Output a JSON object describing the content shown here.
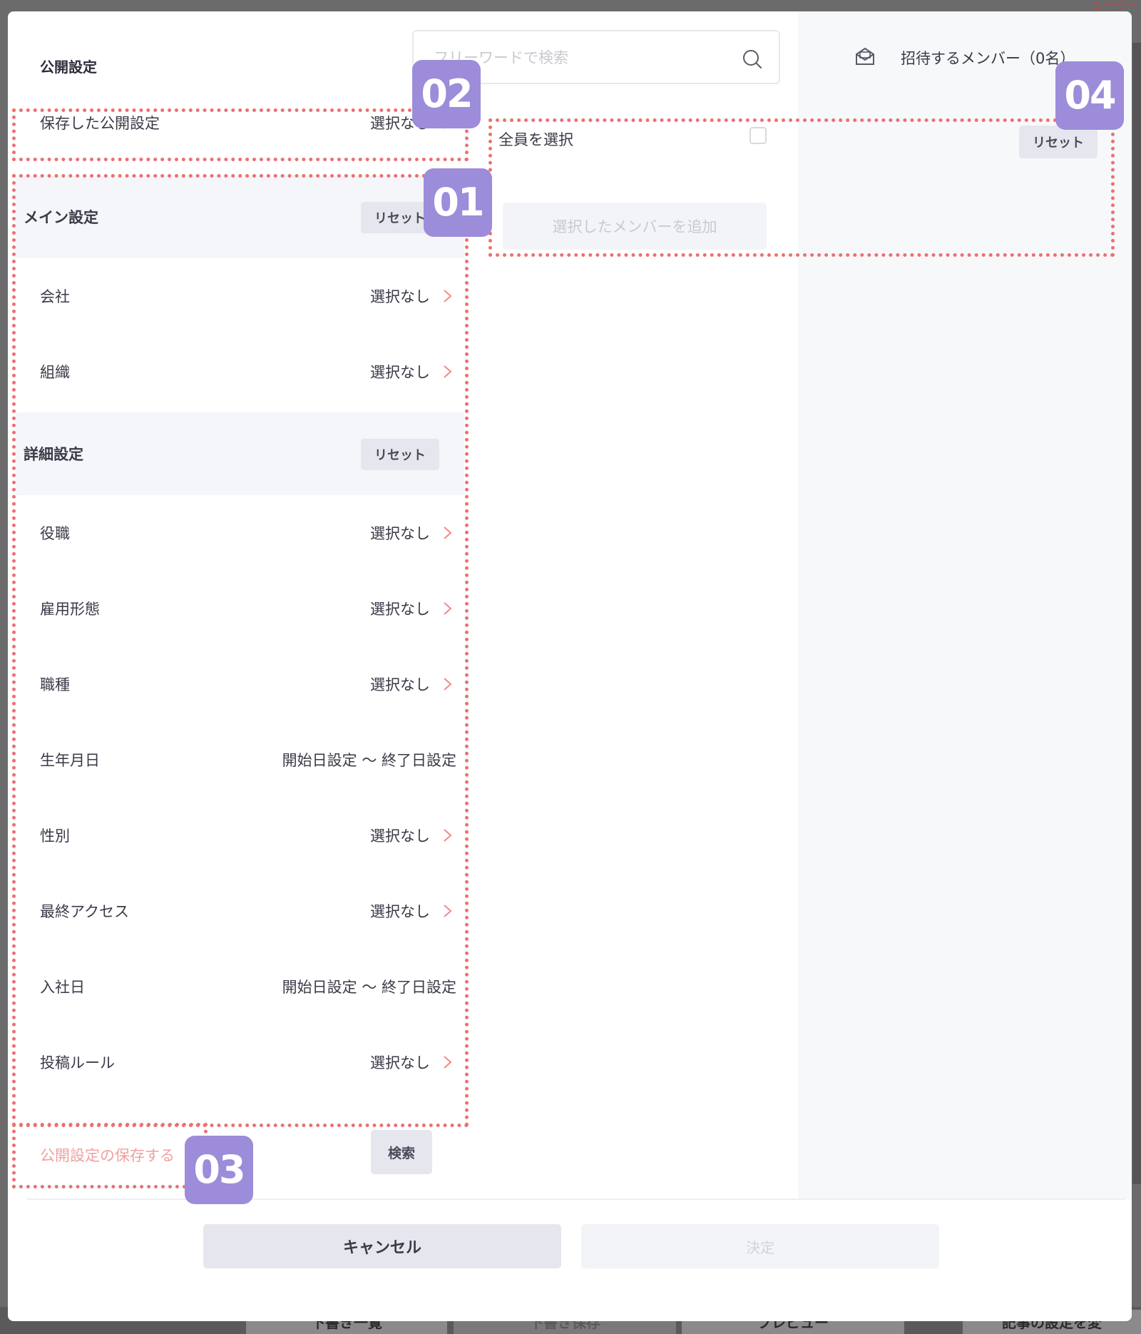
{
  "modal": {
    "title": "公開設定",
    "search_placeholder": "フリーワードで検索",
    "invite_label": "招待するメンバー（0名）"
  },
  "saved_settings": {
    "label": "保存した公開設定",
    "value": "選択なし"
  },
  "main_section": {
    "label": "メイン設定",
    "reset": "リセット",
    "rows": [
      {
        "label": "会社",
        "value": "選択なし"
      },
      {
        "label": "組織",
        "value": "選択なし"
      }
    ]
  },
  "detail_section": {
    "label": "詳細設定",
    "reset": "リセット",
    "rows": [
      {
        "label": "役職",
        "value": "選択なし"
      },
      {
        "label": "雇用形態",
        "value": "選択なし"
      },
      {
        "label": "職種",
        "value": "選択なし"
      },
      {
        "label": "生年月日",
        "value": "開始日設定 〜 終了日設定"
      },
      {
        "label": "性別",
        "value": "選択なし"
      },
      {
        "label": "最終アクセス",
        "value": "選択なし"
      },
      {
        "label": "入社日",
        "value": "開始日設定 〜 終了日設定"
      },
      {
        "label": "投稿ルール",
        "value": "選択なし"
      }
    ]
  },
  "actions": {
    "save_settings": "公開設定の保存する",
    "search": "検索",
    "cancel": "キャンセル",
    "confirm": "決定"
  },
  "members_panel": {
    "select_all": "全員を選択",
    "reset": "リセット",
    "add_selected": "選択したメンバーを追加"
  },
  "annotations": {
    "badge1": "01",
    "badge2": "02",
    "badge3": "03",
    "badge4": "04",
    "color": "#ec7070",
    "badge_color": "#9d8cd9"
  },
  "background": {
    "corner_text": "ユーザー",
    "footer_buttons": [
      "下書き一覧",
      "下書き保存",
      "プレビュー",
      "記事の設定を変"
    ]
  }
}
